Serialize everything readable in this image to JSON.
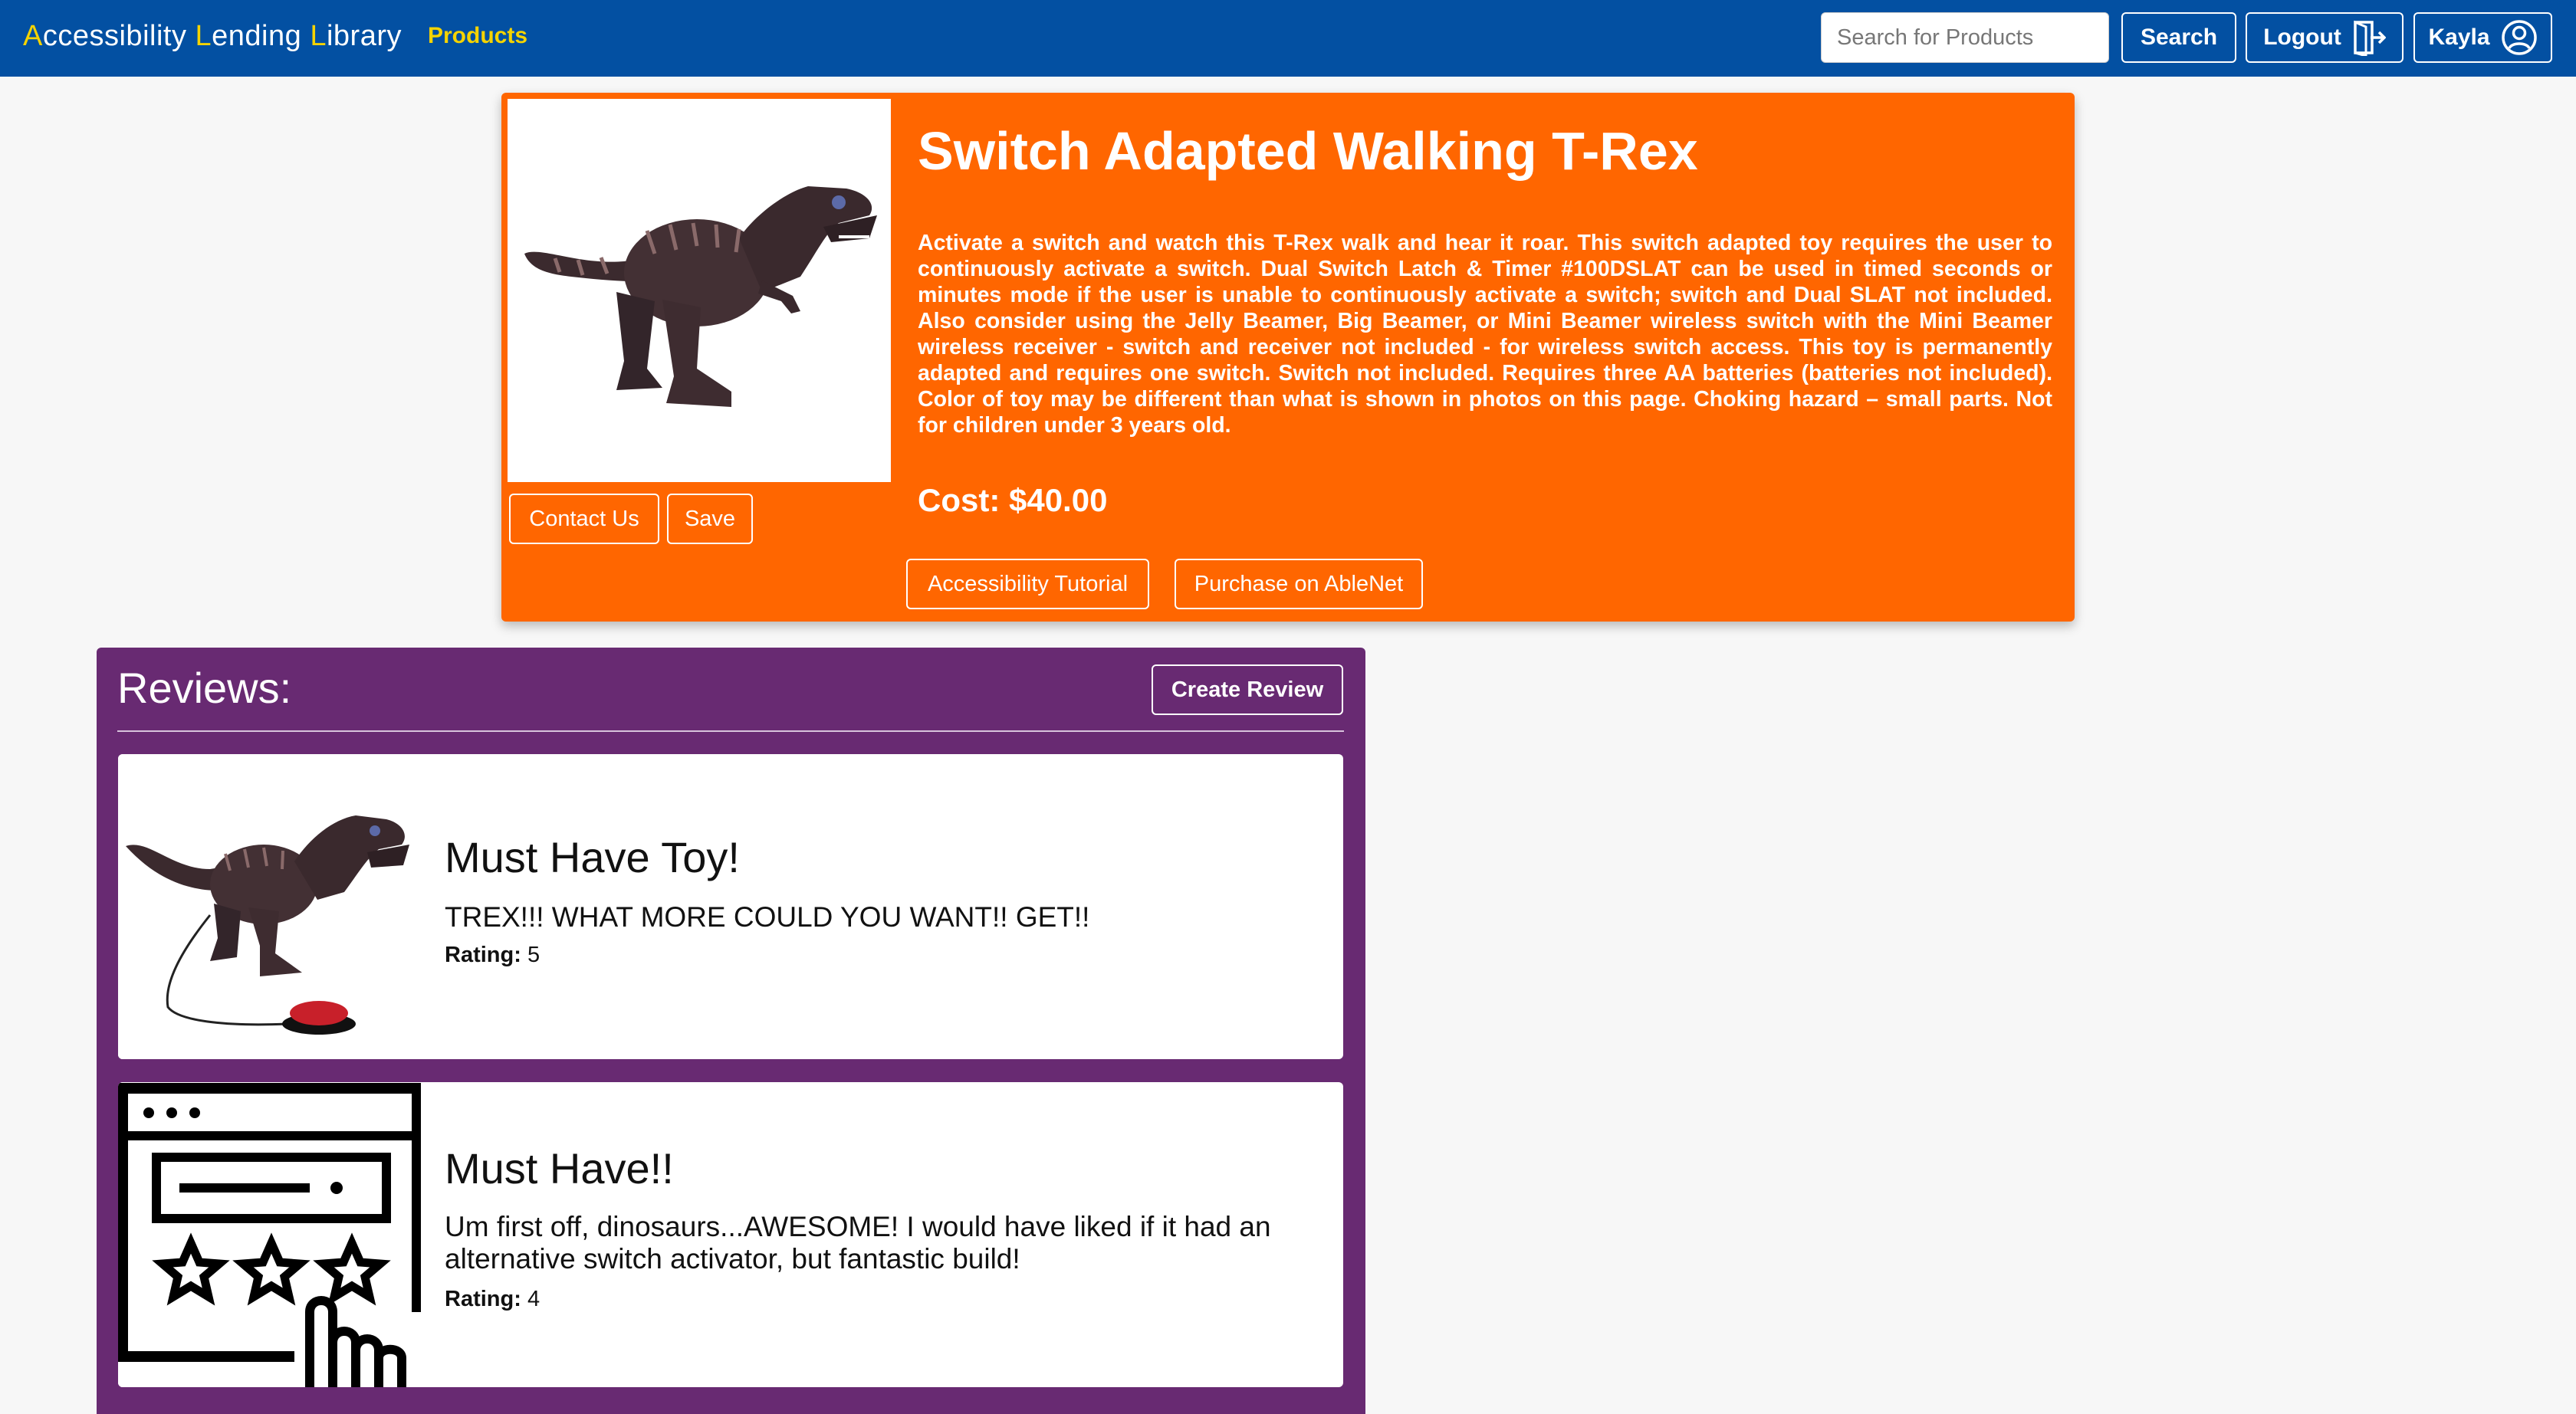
{
  "navbar": {
    "brand_letters": [
      {
        "first": "A",
        "rest": "ccessibility "
      },
      {
        "first": "L",
        "rest": "ending "
      },
      {
        "first": "L",
        "rest": "ibrary"
      }
    ],
    "products_link": "Products",
    "search_placeholder": "Search for Products",
    "search_button": "Search",
    "logout_button": "Logout",
    "user_name": "Kayla"
  },
  "product": {
    "title": "Switch Adapted Walking T-Rex",
    "description": "Activate a switch and watch this T-Rex walk and hear it roar. This switch adapted toy requires the user to continuously activate a switch. Dual Switch Latch & Timer #100DSLAT can be used in timed seconds or minutes mode if the user is unable to continuously activate a switch; switch and Dual SLAT not included. Also consider using the Jelly Beamer, Big Beamer, or Mini Beamer wireless switch with the Mini Beamer wireless receiver - switch and receiver not included - for wireless switch access. This toy is permanently adapted and requires one switch. Switch not included. Requires three AA batteries (batteries not included). Color of toy may be different than what is shown in photos on this page. Choking hazard – small parts. Not for children under 3 years old.",
    "cost": "Cost: $40.00",
    "contact_button": "Contact Us",
    "save_button": "Save",
    "tutorial_button": "Accessibility Tutorial",
    "purchase_button": "Purchase on AbleNet"
  },
  "reviews": {
    "heading": "Reviews:",
    "create_button": "Create Review",
    "rating_label": "Rating:",
    "items": [
      {
        "title": "Must Have Toy!",
        "text": "TREX!!! WHAT MORE COULD YOU WANT!! GET!!",
        "rating": "5"
      },
      {
        "title": "Must Have!!",
        "text": "Um first off, dinosaurs...AWESOME! I would have liked if it had an alternative switch activator, but fantastic build!",
        "rating": "4"
      }
    ]
  },
  "colors": {
    "navbar": "#0350a2",
    "accent_yellow": "#f5d300",
    "product_card": "#ff6600",
    "reviews_panel": "#682a72"
  }
}
